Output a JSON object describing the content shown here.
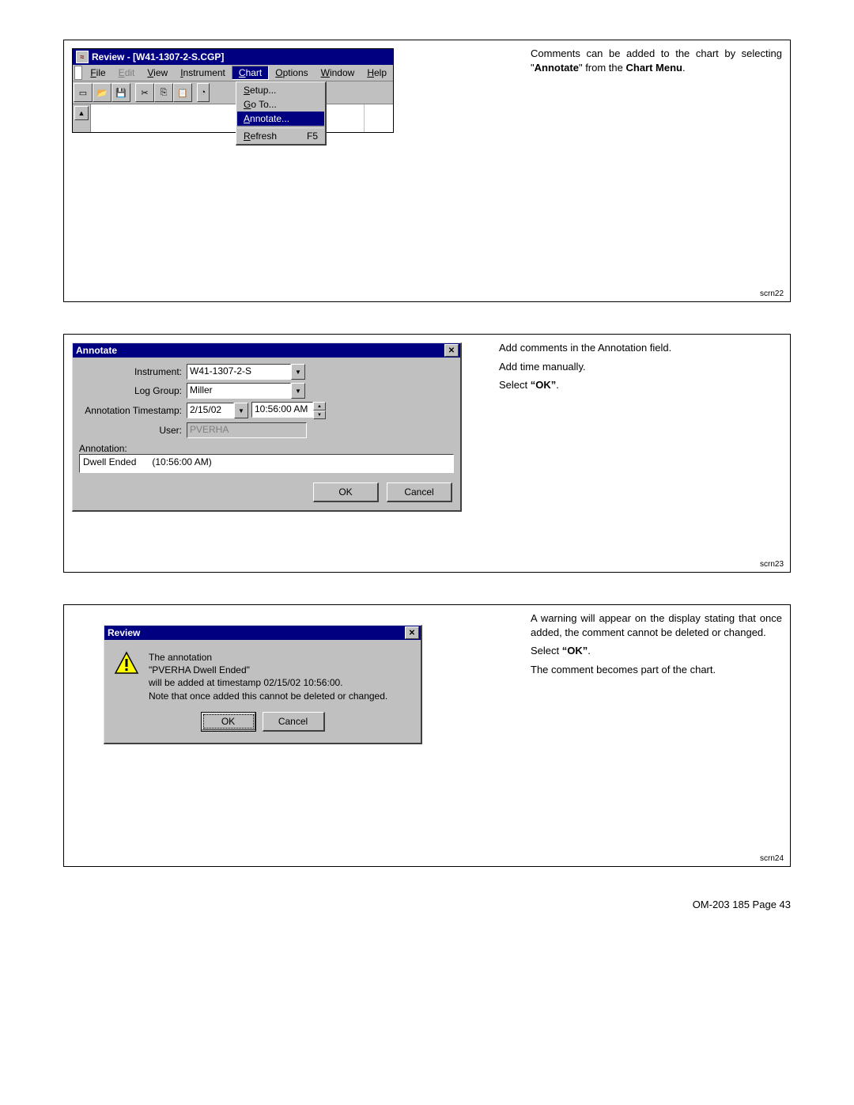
{
  "panel1": {
    "title": "Review - [W41-1307-2-S.CGP]",
    "menus": {
      "file": "File",
      "edit": "Edit",
      "view": "View",
      "instrument": "Instrument",
      "chart": "Chart",
      "options": "Options",
      "window": "Window",
      "help": "Help"
    },
    "dropdown": {
      "setup": "Setup...",
      "goto": "Go To...",
      "annotate": "Annotate...",
      "refresh": "Refresh",
      "refresh_key": "F5"
    },
    "caption_parts": {
      "p1": "Comments can be added to the chart by selecting \"",
      "p2": "Annotate",
      "p3": "\" from the ",
      "p4": "Chart Menu",
      "p5": "."
    },
    "scrn": "scrn22"
  },
  "panel2": {
    "title": "Annotate",
    "labels": {
      "instrument": "Instrument:",
      "loggroup": "Log Group:",
      "timestamp": "Annotation Timestamp:",
      "user": "User:",
      "annotation": "Annotation:"
    },
    "values": {
      "instrument": "W41-1307-2-S",
      "loggroup": "Miller",
      "date": "2/15/02",
      "time": "10:56:00 AM",
      "user": "PVERHA",
      "ann_text": "Dwell Ended",
      "ann_time": "(10:56:00 AM)"
    },
    "buttons": {
      "ok": "OK",
      "cancel": "Cancel"
    },
    "caption": {
      "l1": "Add comments in the Annotation field.",
      "l2": "Add time manually.",
      "l3a": "Select ",
      "l3b": "“OK”",
      "l3c": "."
    },
    "scrn": "scrn23"
  },
  "panel3": {
    "title": "Review",
    "msg": {
      "l1": "The annotation",
      "l2": "\"PVERHA Dwell Ended\"",
      "l3": "will be added at timestamp 02/15/02 10:56:00.",
      "l4": "Note that once added this cannot be deleted or changed."
    },
    "buttons": {
      "ok": "OK",
      "cancel": "Cancel"
    },
    "caption": {
      "l1": "A warning will appear on the display stating that once added, the comment cannot be deleted or changed.",
      "l2a": "Select ",
      "l2b": "“OK”",
      "l2c": ".",
      "l3": "The comment becomes part of the chart."
    },
    "scrn": "scrn24"
  },
  "footer": "OM-203 185 Page 43"
}
